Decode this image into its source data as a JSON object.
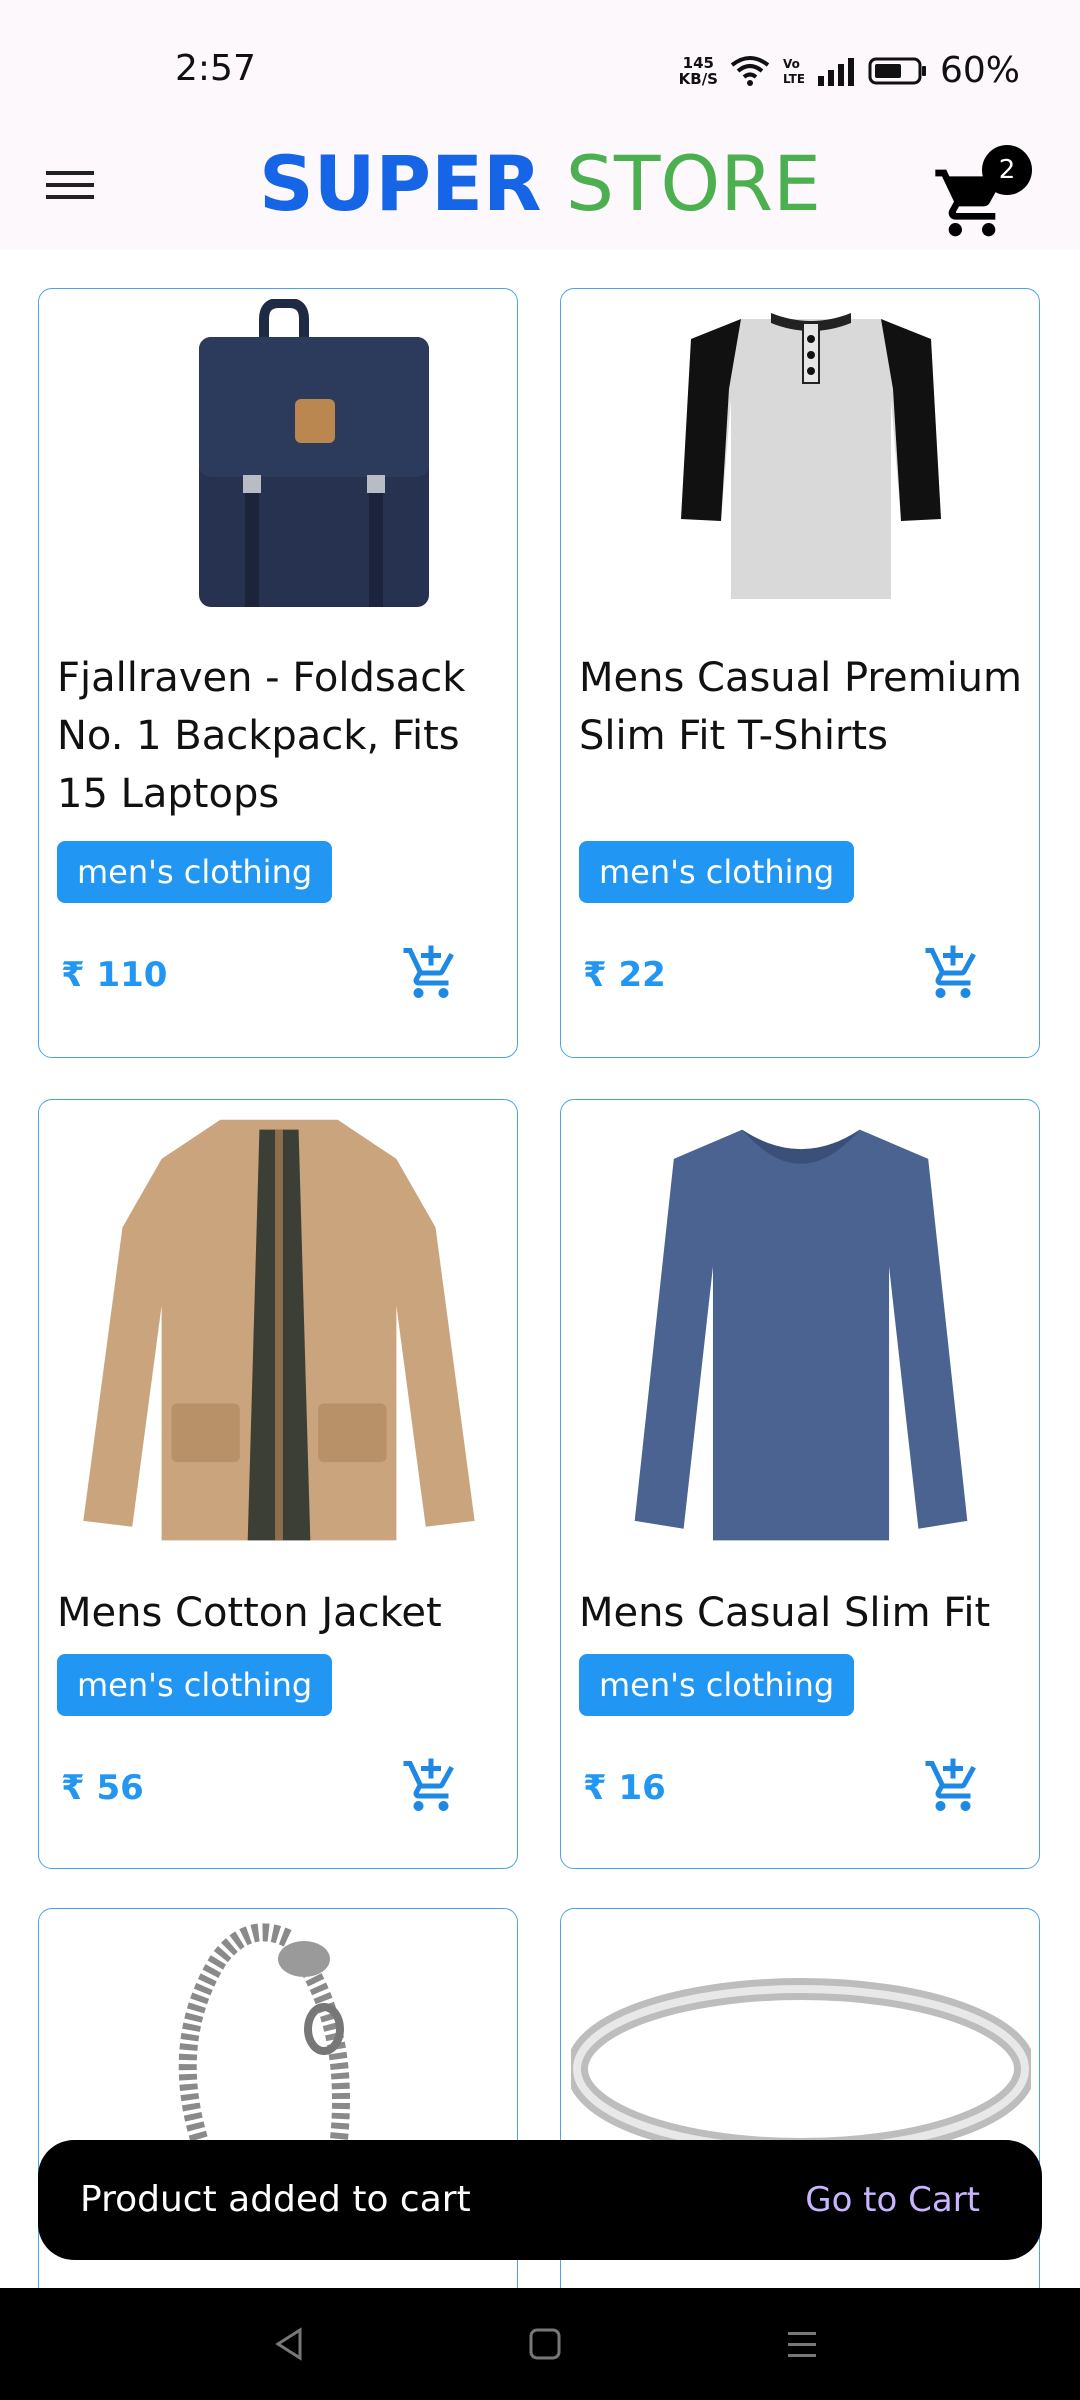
{
  "status_bar": {
    "time": "2:57",
    "net_speed_top": "145",
    "net_speed_bottom": "KB/S",
    "battery_percent": "60%"
  },
  "header": {
    "brand_part1": "SUPER",
    "brand_part2": "STORE",
    "cart_count": "2"
  },
  "products": [
    {
      "title": "Fjallraven - Foldsack No. 1 Backpack, Fits 15 Laptops",
      "category": "men's clothing",
      "price": "₹ 110"
    },
    {
      "title": "Mens Casual Premium Slim Fit T-Shirts",
      "category": "men's clothing",
      "price": "₹ 22"
    },
    {
      "title": "Mens Cotton Jacket",
      "category": "men's clothing",
      "price": "₹ 56"
    },
    {
      "title": "Mens Casual Slim Fit",
      "category": "men's clothing",
      "price": "₹ 16"
    }
  ],
  "snackbar": {
    "message": "Product added to cart",
    "action": "Go to Cart"
  },
  "colors": {
    "brand_blue": "#1565e6",
    "brand_green": "#4caf50",
    "accent": "#2196f3"
  }
}
